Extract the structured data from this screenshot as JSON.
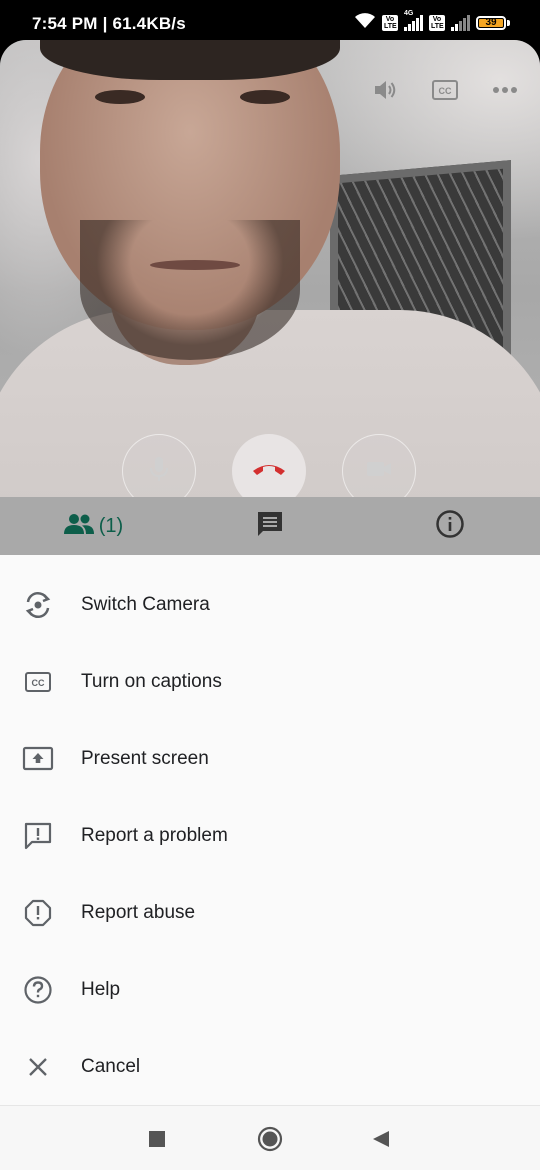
{
  "status_bar": {
    "time": "7:54 PM | 61.4KB/s",
    "network_label": "4G",
    "volte_label_1": "Vo LTE",
    "volte_label_2": "Vo LTE",
    "battery": "39",
    "battery_color": "#f5a623"
  },
  "video": {
    "top_icons": [
      "volume-icon",
      "cc-icon",
      "more-icon"
    ]
  },
  "call_controls": {
    "end_call_color": "#d32f2f"
  },
  "call_tabs": {
    "participants_count": "(1)",
    "accent": "#0d5e4a"
  },
  "menu": {
    "items": [
      {
        "label": "Switch Camera",
        "icon": "switch-camera-icon"
      },
      {
        "label": "Turn on captions",
        "icon": "captions-icon"
      },
      {
        "label": "Present screen",
        "icon": "present-screen-icon"
      },
      {
        "label": "Report a problem",
        "icon": "report-problem-icon"
      },
      {
        "label": "Report abuse",
        "icon": "report-abuse-icon"
      },
      {
        "label": "Help",
        "icon": "help-icon"
      },
      {
        "label": "Cancel",
        "icon": "close-icon"
      }
    ]
  },
  "nav_bar": {
    "buttons": [
      "recents-icon",
      "home-icon",
      "back-icon"
    ]
  }
}
